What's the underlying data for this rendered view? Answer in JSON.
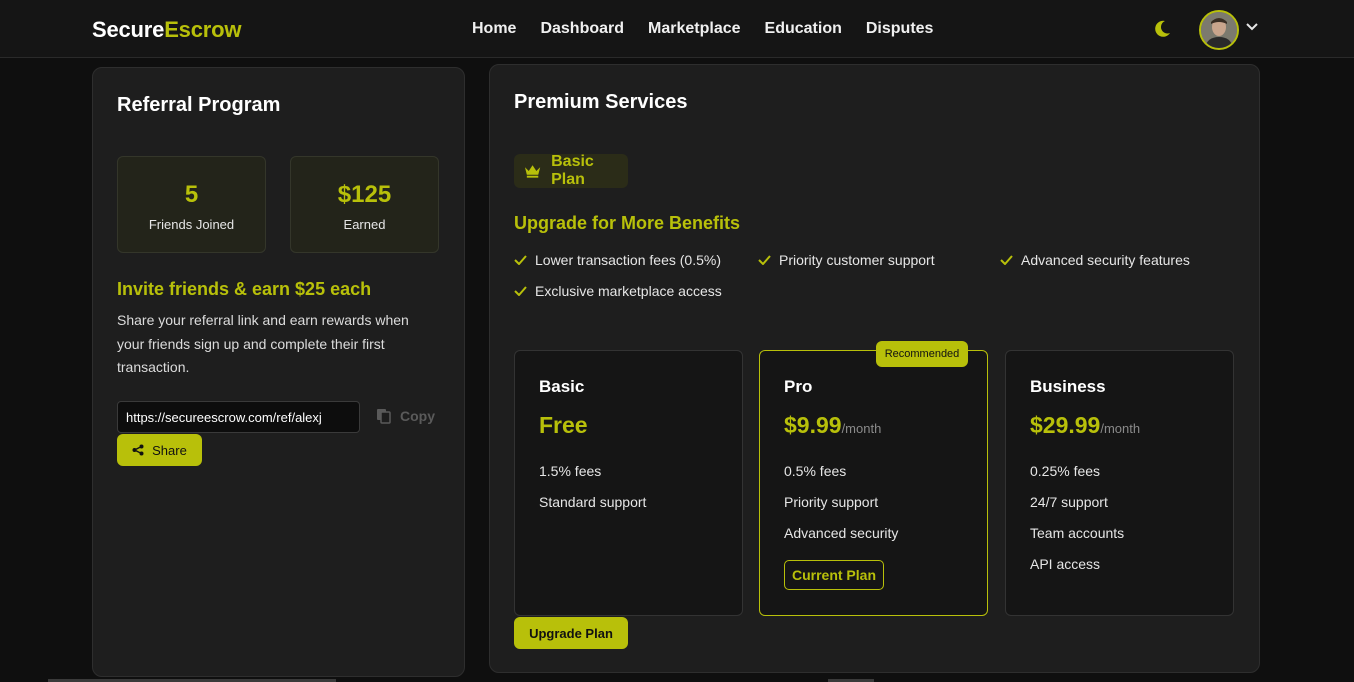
{
  "header": {
    "logo_part1": "Secure",
    "logo_part2": "Escrow",
    "nav": [
      "Home",
      "Dashboard",
      "Marketplace",
      "Education",
      "Disputes"
    ],
    "theme_icon": "moon-icon",
    "accent_color": "#b8c00a"
  },
  "referral": {
    "title": "Referral Program",
    "stats": [
      {
        "value": "5",
        "label": "Friends Joined"
      },
      {
        "value": "$125",
        "label": "Earned"
      }
    ],
    "invite_heading": "Invite friends & earn $25 each",
    "invite_description": "Share your referral link and earn rewards when your friends sign up and complete their first transaction.",
    "link_value": "https://secureescrow.com/ref/alexj",
    "copy_label": "Copy",
    "share_label": "Share"
  },
  "premium": {
    "title": "Premium Services",
    "current_plan_badge": "Basic Plan",
    "upgrade_heading": "Upgrade for More Benefits",
    "benefits": [
      "Lower transaction fees (0.5%)",
      "Priority customer support",
      "Advanced security features",
      "Exclusive marketplace access"
    ],
    "plans": [
      {
        "name": "Basic",
        "price": "Free",
        "per": "",
        "features": [
          "1.5% fees",
          "Standard support"
        ]
      },
      {
        "name": "Pro",
        "price": "$9.99",
        "per": "/month",
        "badge": "Recommended",
        "features": [
          "0.5% fees",
          "Priority support",
          "Advanced security"
        ],
        "button": "Current Plan"
      },
      {
        "name": "Business",
        "price": "$29.99",
        "per": "/month",
        "features": [
          "0.25% fees",
          "24/7 support",
          "Team accounts",
          "API access"
        ]
      }
    ],
    "upgrade_button": "Upgrade Plan"
  }
}
